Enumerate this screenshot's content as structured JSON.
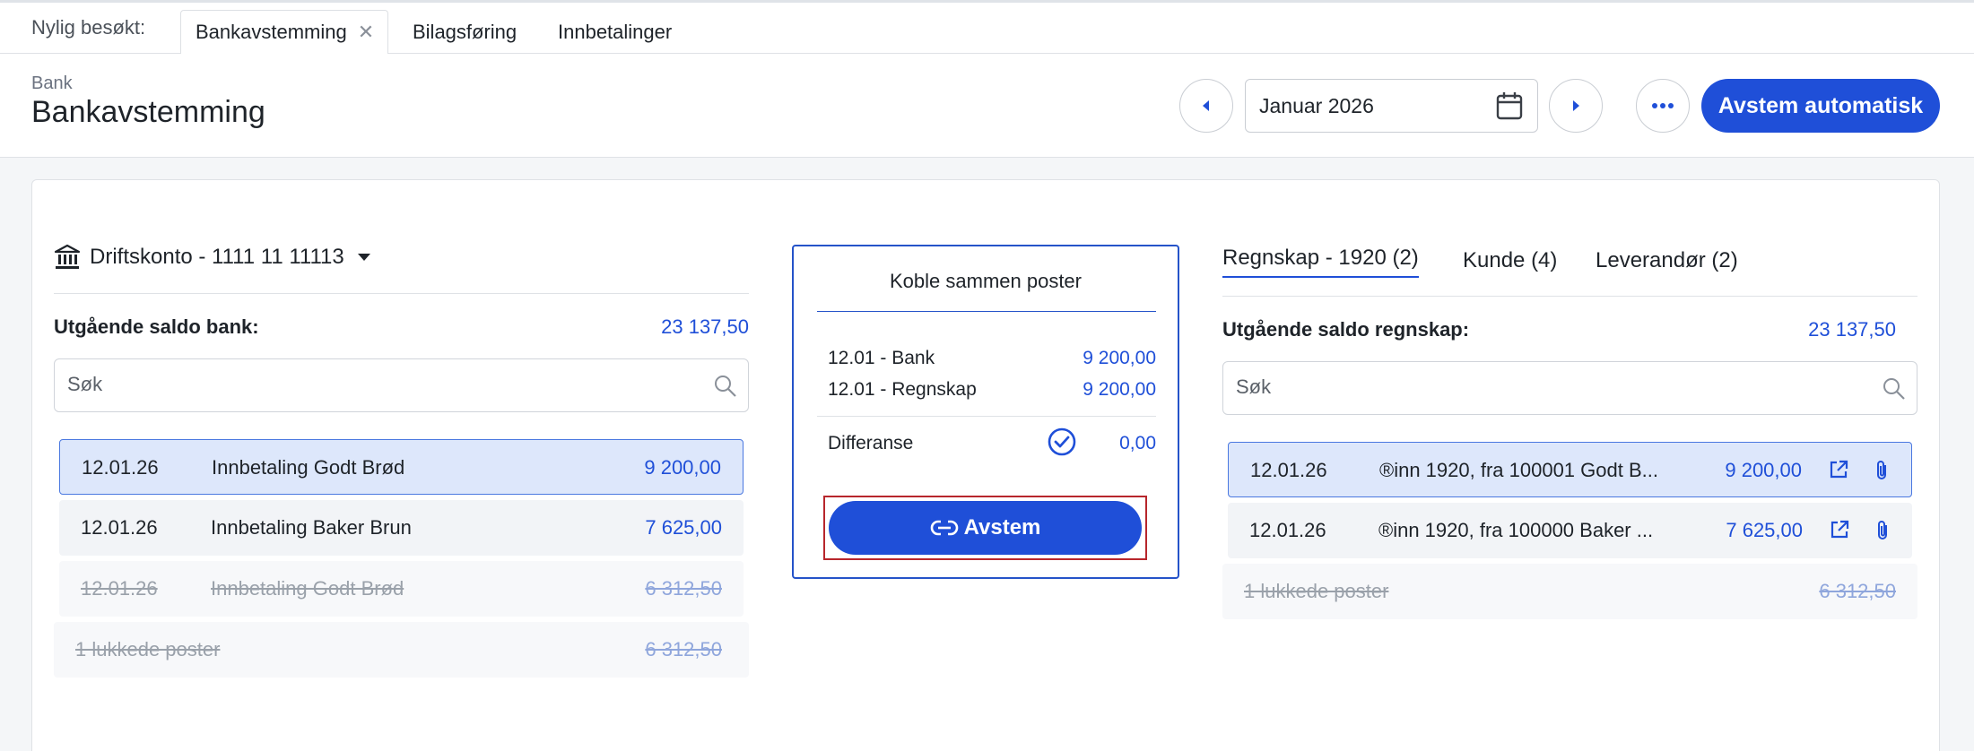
{
  "tabbar": {
    "recent_label": "Nylig besøkt:",
    "tabs": [
      {
        "label": "Bankavstemming",
        "close": "✕"
      },
      {
        "label": "Bilagsføring"
      },
      {
        "label": "Innbetalinger"
      }
    ]
  },
  "header": {
    "breadcrumb": "Bank",
    "title": "Bankavstemming",
    "period": "Januar 2026",
    "auto_button": "Avstem automatisk",
    "icons": [
      "chevron-left-icon",
      "calendar-icon",
      "chevron-right-icon",
      "more-icon"
    ]
  },
  "bank": {
    "account": "Driftskonto - 1111 11 11113",
    "saldo_label": "Utgående saldo bank:",
    "saldo_value": "23 137,50",
    "search_placeholder": "Søk",
    "rows": [
      {
        "date": "12.01.26",
        "text": "Innbetaling Godt Brød",
        "amount": "9 200,00",
        "state": "selected"
      },
      {
        "date": "12.01.26",
        "text": "Innbetaling Baker Brun",
        "amount": "7 625,00",
        "state": "open"
      },
      {
        "date": "12.01.26",
        "text": "Innbetaling Godt Brød",
        "amount": "6 312,50",
        "state": "closed"
      }
    ],
    "closed_summary": {
      "label": "1 lukkede poster",
      "amount": "6 312,50"
    }
  },
  "match": {
    "title": "Koble sammen poster",
    "lines": [
      {
        "label": "12.01 - Bank",
        "value": "9 200,00"
      },
      {
        "label": "12.01 - Regnskap",
        "value": "9 200,00"
      }
    ],
    "diff_label": "Differanse",
    "diff_value": "0,00",
    "button": "Avstem"
  },
  "ledger": {
    "tabs": [
      {
        "label": "Regnskap - 1920 (2)",
        "active": true
      },
      {
        "label": "Kunde (4)"
      },
      {
        "label": "Leverandør (2)"
      }
    ],
    "saldo_label": "Utgående saldo regnskap:",
    "saldo_value": "23 137,50",
    "search_placeholder": "Søk",
    "rows": [
      {
        "date": "12.01.26",
        "text": "®inn 1920, fra 100001 Godt B...",
        "amount": "9 200,00",
        "state": "selected"
      },
      {
        "date": "12.01.26",
        "text": "®inn 1920, fra 100000 Baker ...",
        "amount": "7 625,00",
        "state": "open"
      }
    ],
    "closed_summary": {
      "label": "1 lukkede poster",
      "amount": "6 312,50"
    }
  },
  "colors": {
    "primary": "#1f4fd8",
    "selected_row": "#dde7fb",
    "focus_outline": "#b7262c"
  }
}
